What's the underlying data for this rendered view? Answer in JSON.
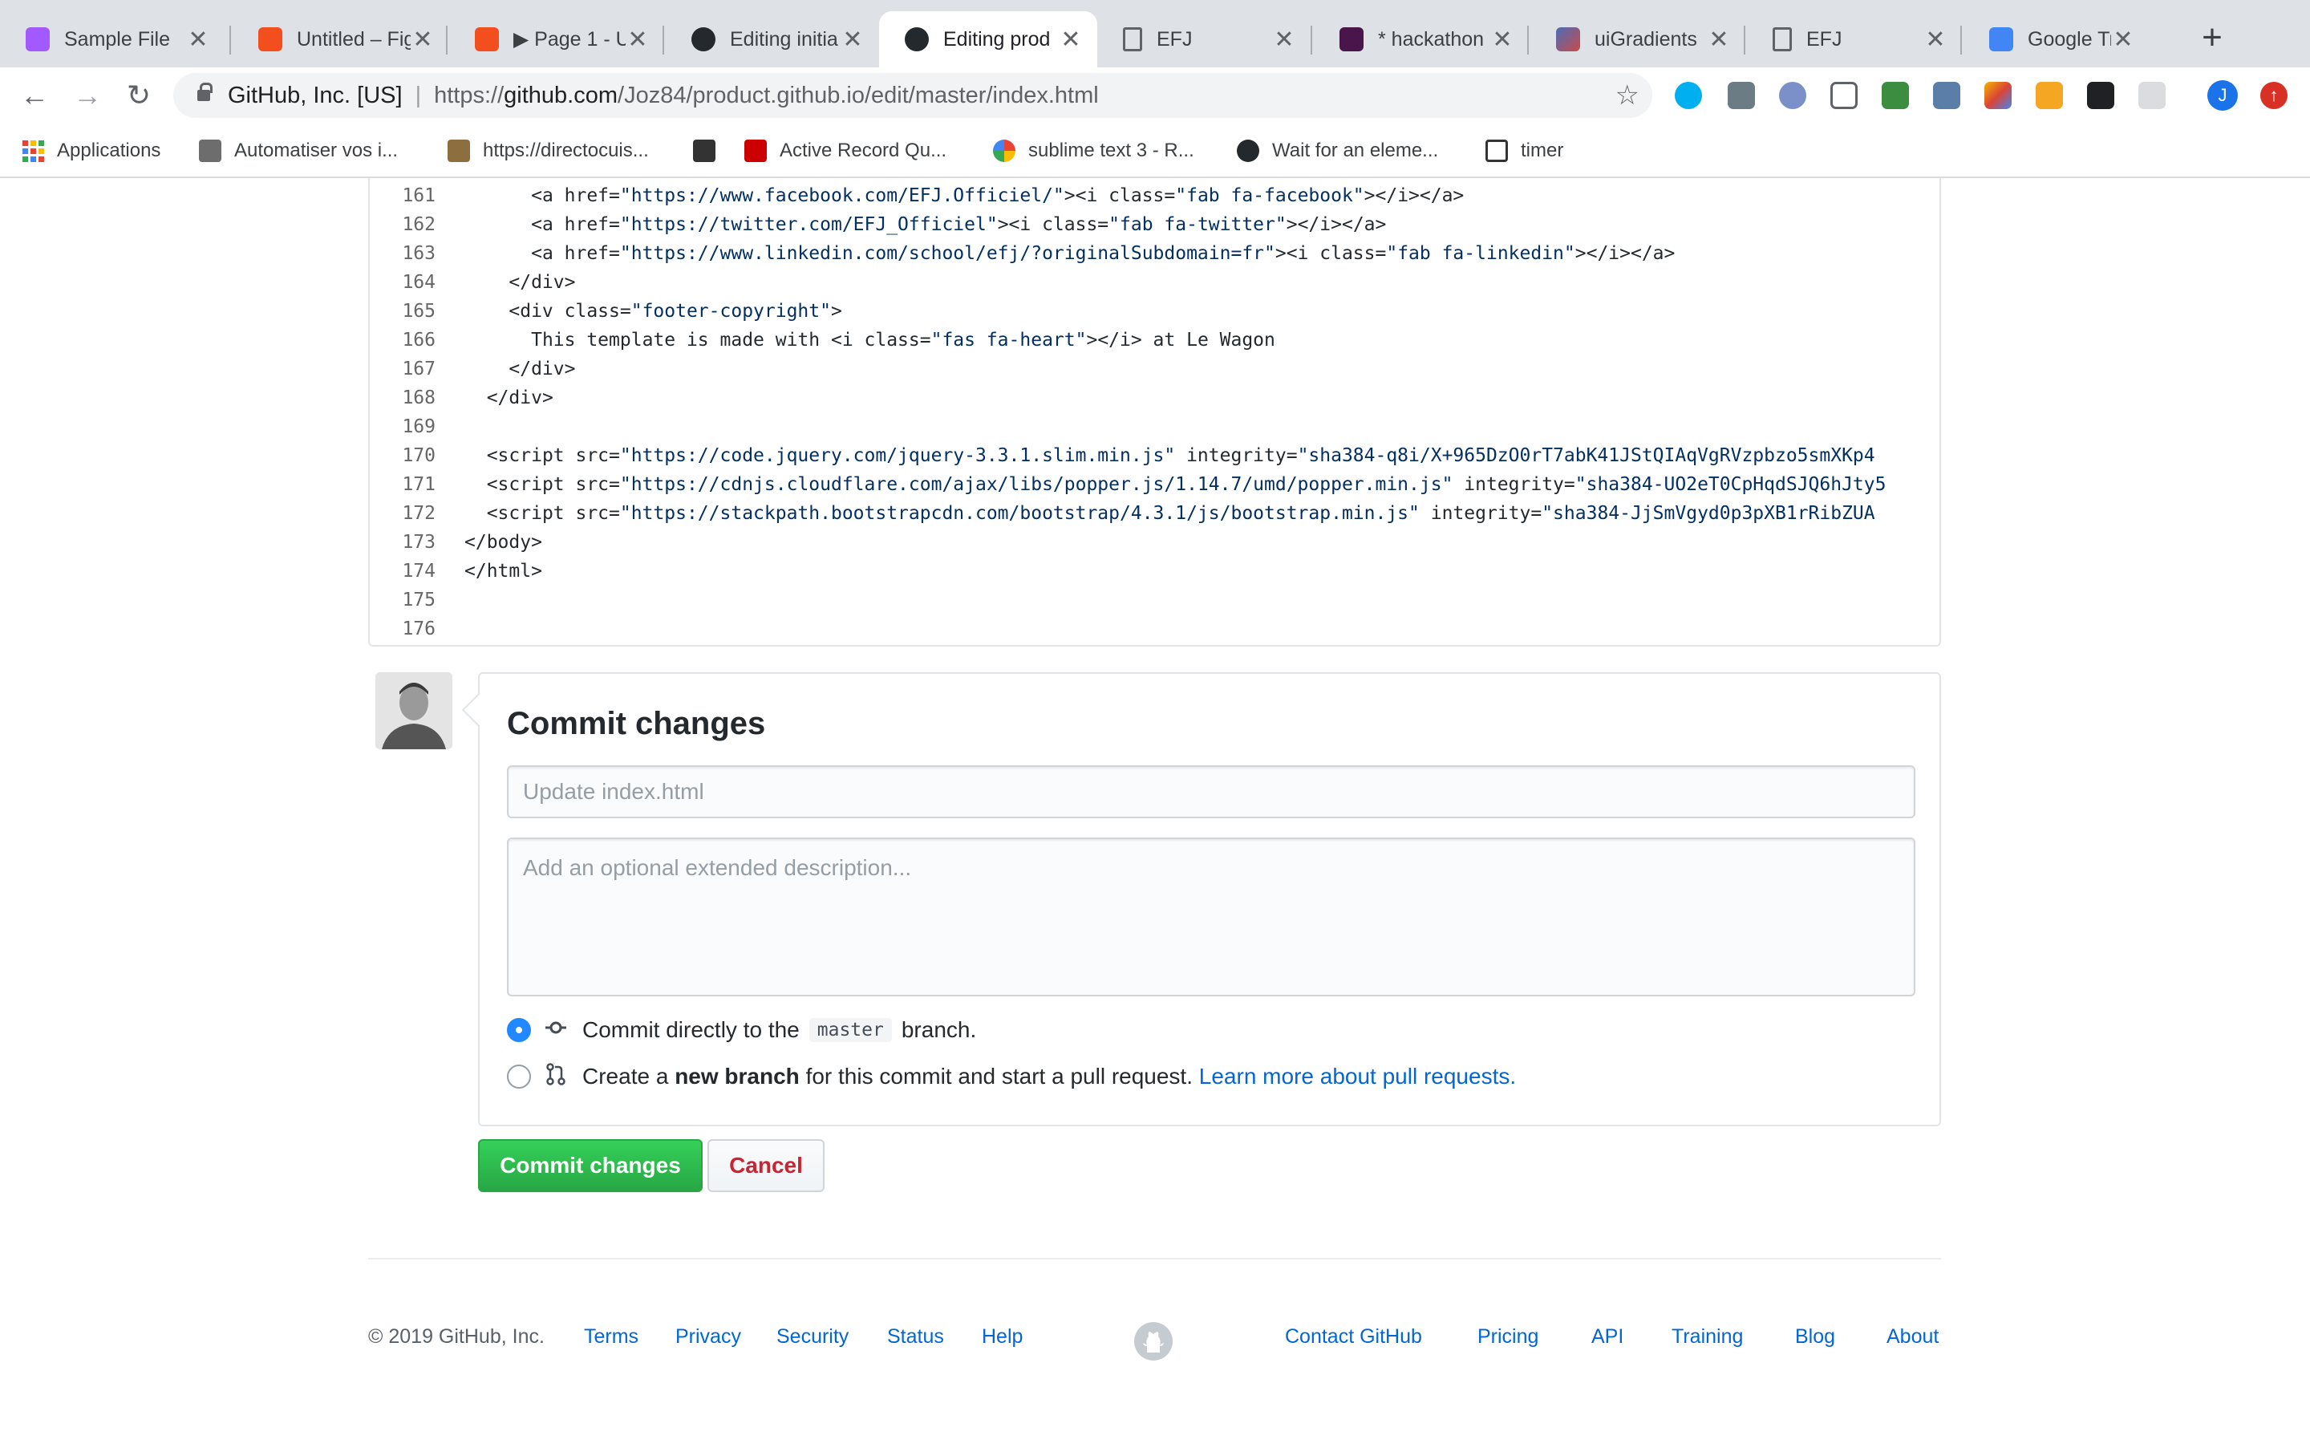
{
  "browser": {
    "tabs": [
      {
        "title": "Sample File",
        "icon": "figma-icon",
        "color": "#a259ff"
      },
      {
        "title": "Untitled – Figma",
        "icon": "figma-icon",
        "color": "#f24e1e"
      },
      {
        "title": "▶ Page 1 - U",
        "icon": "figma-icon",
        "color": "#f24e1e"
      },
      {
        "title": "Editing initia",
        "icon": "github-icon",
        "color": "#24292e"
      },
      {
        "title": "Editing prod",
        "icon": "github-icon",
        "color": "#24292e",
        "active": true
      },
      {
        "title": "EFJ",
        "icon": "document-icon",
        "color": "#5f6368"
      },
      {
        "title": "* hackathon",
        "icon": "slack-icon",
        "color": "#4a154b"
      },
      {
        "title": "uiGradients",
        "icon": "gradient-icon",
        "color": "#c94b4b"
      },
      {
        "title": "EFJ",
        "icon": "document-icon",
        "color": "#5f6368"
      },
      {
        "title": "Google Trad",
        "icon": "google-translate-icon",
        "color": "#4285f4"
      }
    ],
    "close_glyph": "✕",
    "new_tab_glyph": "+",
    "nav": {
      "back": "←",
      "forward": "→",
      "reload": "↻"
    },
    "site_identity": "GitHub, Inc. [US]",
    "url_scheme": "https://",
    "url_host": "github.com",
    "url_path": "/Joz84/product.github.io/edit/master/index.html",
    "star_glyph": "☆",
    "profile_initial": "J",
    "update_glyph": "↑",
    "bookmarks": [
      {
        "label": "Applications",
        "icon": "apps-grid-icon"
      },
      {
        "label": "Automatiser vos i...",
        "icon": "bookmark-icon"
      },
      {
        "label": "https://directocuis...",
        "icon": "bookmark-icon"
      },
      {
        "label": "Active Record Qu...",
        "icon": "rails-icon"
      },
      {
        "label": "sublime text 3 - R...",
        "icon": "google-icon"
      },
      {
        "label": "Wait for an eleme...",
        "icon": "github-icon"
      },
      {
        "label": "timer",
        "icon": "timer-icon"
      }
    ]
  },
  "editor": {
    "lines": [
      {
        "n": "161",
        "indent": "      ",
        "parts": [
          [
            "<a href=",
            ""
          ],
          [
            "\"https://www.facebook.com/EFJ.Officiel/\"",
            "str"
          ],
          [
            "><i class=",
            ""
          ],
          [
            "\"fab fa-facebook\"",
            "str"
          ],
          [
            "></i></a>",
            ""
          ]
        ]
      },
      {
        "n": "162",
        "indent": "      ",
        "parts": [
          [
            "<a href=",
            ""
          ],
          [
            "\"https://twitter.com/EFJ_Officiel\"",
            "str"
          ],
          [
            "><i class=",
            ""
          ],
          [
            "\"fab fa-twitter\"",
            "str"
          ],
          [
            "></i></a>",
            ""
          ]
        ]
      },
      {
        "n": "163",
        "indent": "      ",
        "parts": [
          [
            "<a href=",
            ""
          ],
          [
            "\"https://www.linkedin.com/school/efj/?originalSubdomain=fr\"",
            "str"
          ],
          [
            "><i class=",
            ""
          ],
          [
            "\"fab fa-linkedin\"",
            "str"
          ],
          [
            "></i></a>",
            ""
          ]
        ]
      },
      {
        "n": "164",
        "indent": "    ",
        "parts": [
          [
            "</div>",
            ""
          ]
        ]
      },
      {
        "n": "165",
        "indent": "    ",
        "parts": [
          [
            "<div class=",
            ""
          ],
          [
            "\"footer-copyright\"",
            "str"
          ],
          [
            ">",
            ""
          ]
        ]
      },
      {
        "n": "166",
        "indent": "      ",
        "parts": [
          [
            "This template is made with <i class=",
            ""
          ],
          [
            "\"fas fa-heart\"",
            "str"
          ],
          [
            "></i> at Le Wagon",
            ""
          ]
        ]
      },
      {
        "n": "167",
        "indent": "    ",
        "parts": [
          [
            "</div>",
            ""
          ]
        ]
      },
      {
        "n": "168",
        "indent": "  ",
        "parts": [
          [
            "</div>",
            ""
          ]
        ]
      },
      {
        "n": "169",
        "indent": "",
        "parts": []
      },
      {
        "n": "170",
        "indent": "  ",
        "parts": [
          [
            "<script src=",
            ""
          ],
          [
            "\"https://code.jquery.com/jquery-3.3.1.slim.min.js\"",
            "str"
          ],
          [
            " integrity=",
            ""
          ],
          [
            "\"sha384-q8i/X+965DzO0rT7abK41JStQIAqVgRVzpbzo5smXKp4",
            "str"
          ]
        ]
      },
      {
        "n": "171",
        "indent": "  ",
        "parts": [
          [
            "<script src=",
            ""
          ],
          [
            "\"https://cdnjs.cloudflare.com/ajax/libs/popper.js/1.14.7/umd/popper.min.js\"",
            "str"
          ],
          [
            " integrity=",
            ""
          ],
          [
            "\"sha384-UO2eT0CpHqdSJQ6hJty5",
            "str"
          ]
        ]
      },
      {
        "n": "172",
        "indent": "  ",
        "parts": [
          [
            "<script src=",
            ""
          ],
          [
            "\"https://stackpath.bootstrapcdn.com/bootstrap/4.3.1/js/bootstrap.min.js\"",
            "str"
          ],
          [
            " integrity=",
            ""
          ],
          [
            "\"sha384-JjSmVgyd0p3pXB1rRibZUA",
            "str"
          ]
        ]
      },
      {
        "n": "173",
        "indent": "",
        "parts": [
          [
            "</body>",
            ""
          ]
        ]
      },
      {
        "n": "174",
        "indent": "",
        "parts": [
          [
            "</html>",
            ""
          ]
        ]
      },
      {
        "n": "175",
        "indent": "",
        "parts": []
      },
      {
        "n": "176",
        "indent": "",
        "parts": []
      }
    ]
  },
  "commit": {
    "title": "Commit changes",
    "summary_placeholder": "Update index.html",
    "description_placeholder": "Add an optional extended description...",
    "option_direct": {
      "prefix": "Commit directly to the",
      "branch": "master",
      "suffix": "branch."
    },
    "option_new": {
      "prefix": "Create a",
      "bold": "new branch",
      "suffix": "for this commit and start a pull request.",
      "link": "Learn more about pull requests."
    },
    "submit_label": "Commit changes",
    "cancel_label": "Cancel"
  },
  "footer": {
    "copyright": "© 2019 GitHub, Inc.",
    "left_links": [
      "Terms",
      "Privacy",
      "Security",
      "Status",
      "Help"
    ],
    "right_links": [
      "Contact GitHub",
      "Pricing",
      "API",
      "Training",
      "Blog",
      "About"
    ]
  }
}
